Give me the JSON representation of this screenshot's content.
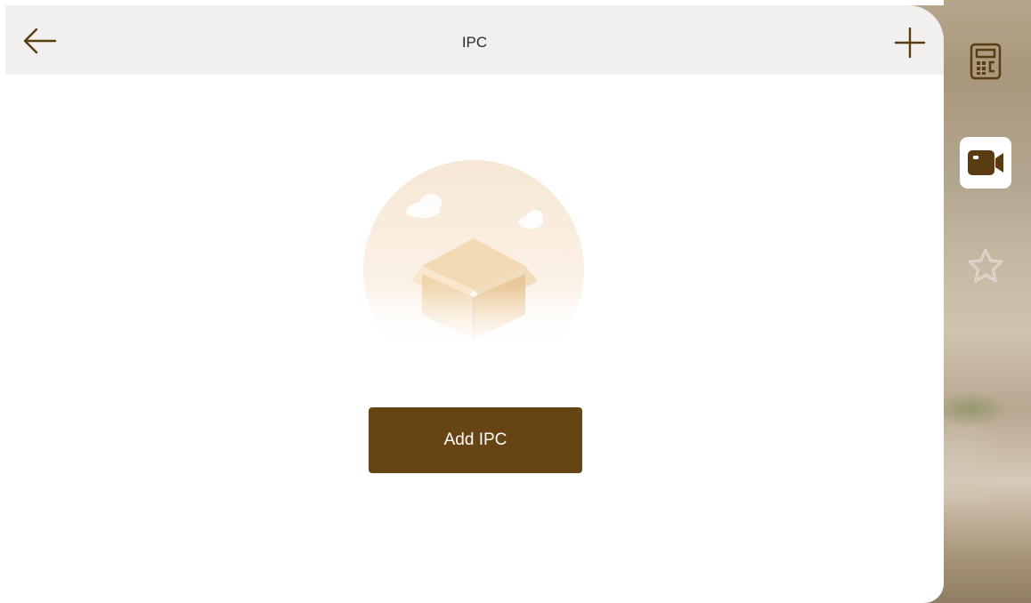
{
  "header": {
    "title": "IPC",
    "back_icon": "arrow-left-icon",
    "add_icon": "plus-icon"
  },
  "empty_state": {
    "illustration": "empty-box-illustration",
    "button_label": "Add IPC"
  },
  "side_panel": {
    "items": [
      {
        "icon": "calculator-icon",
        "active": false
      },
      {
        "icon": "video-camera-icon",
        "active": true
      },
      {
        "icon": "star-icon",
        "active": false
      }
    ]
  },
  "colors": {
    "accent": "#664414",
    "header_bg": "#f2f0ee",
    "icon_brown": "#5a3c12"
  }
}
